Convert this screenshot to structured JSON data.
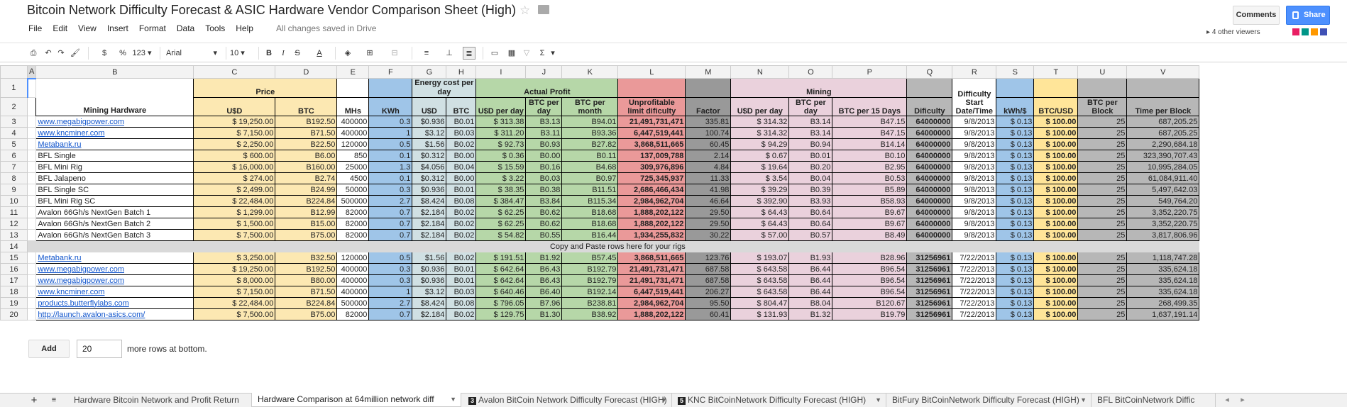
{
  "doc": {
    "title": "Bitcoin Network Difficulty Forecast & ASIC Hardware Vendor Comparison Sheet (High)",
    "comments_label": "Comments",
    "share_label": "Share",
    "saved_status": "All changes saved in Drive",
    "viewers": "4 other viewers",
    "viewer_colors": [
      "#e91e63",
      "#009688",
      "#ff9800",
      "#3f51b5"
    ]
  },
  "menu": [
    "File",
    "Edit",
    "View",
    "Insert",
    "Format",
    "Data",
    "Tools",
    "Help"
  ],
  "toolbar": {
    "font_name": "Arial",
    "font_size": "10",
    "currency": "$",
    "percent": "%",
    "number_format": "123"
  },
  "columns": [
    "",
    "A",
    "B",
    "C",
    "D",
    "E",
    "F",
    "G",
    "H",
    "I",
    "J",
    "K",
    "L",
    "M",
    "N",
    "O",
    "P",
    "Q",
    "R",
    "S",
    "T",
    "U",
    "V"
  ],
  "header": {
    "price": "Price",
    "energy": "Energy cost per day",
    "actual_profit": "Actual Profit",
    "mining": "Mining",
    "mining_hardware": "Mining Hardware",
    "usd": "U$D",
    "btc": "BTC",
    "mhs": "MHs",
    "kwh": "KWh",
    "energy_usd": "U$D",
    "energy_btc": "BTC",
    "usd_per_day": "U$D per day",
    "btc_per_day": "BTC per day",
    "btc_per_month": "BTC per month",
    "unprofitable": "Unprofitable limit dificulty",
    "factor": "Factor",
    "mining_usd_per_day": "U$D per day",
    "mining_btc_per_day": "BTC per day",
    "btc_per_15": "BTC per 15 Days",
    "dificulty": "Dificulty",
    "start": "Difficulty Start Date/Time",
    "kwh_usd": "kWh/$",
    "btc_usd": "BTC/USD",
    "btc_per_block": "BTC per Block",
    "time_per_block": "Time per Block"
  },
  "rows_a": [
    {
      "n": "3",
      "name": "www.megabigpower.com",
      "link": true,
      "usd": "$ 19,250.00",
      "btc": "B192.50",
      "mhs": "400000",
      "kwh": "0.3",
      "eusd": "$0.936",
      "ebtc": "B0.01",
      "pusd": "$ 313.38",
      "pbtc": "B3.13",
      "pmon": "B94.01",
      "unp": "21,491,731,471",
      "fac": "335.81",
      "musd": "$ 314.32",
      "mbtc": "B3.14",
      "m15": "B47.15",
      "dif": "64000000",
      "date": "9/8/2013",
      "kw": "$ 0.13",
      "bu": "$ 100.00",
      "bpb": "25",
      "tpb": "687,205.25"
    },
    {
      "n": "4",
      "name": "www.kncminer.com",
      "link": true,
      "usd": "$ 7,150.00",
      "btc": "B71.50",
      "mhs": "400000",
      "kwh": "1",
      "eusd": "$3.12",
      "ebtc": "B0.03",
      "pusd": "$ 311.20",
      "pbtc": "B3.11",
      "pmon": "B93.36",
      "unp": "6,447,519,441",
      "fac": "100.74",
      "musd": "$ 314.32",
      "mbtc": "B3.14",
      "m15": "B47.15",
      "dif": "64000000",
      "date": "9/8/2013",
      "kw": "$ 0.13",
      "bu": "$ 100.00",
      "bpb": "25",
      "tpb": "687,205.25"
    },
    {
      "n": "5",
      "name": "Metabank.ru",
      "link": true,
      "usd": "$ 2,250.00",
      "btc": "B22.50",
      "mhs": "120000",
      "kwh": "0.5",
      "eusd": "$1.56",
      "ebtc": "B0.02",
      "pusd": "$ 92.73",
      "pbtc": "B0.93",
      "pmon": "B27.82",
      "unp": "3,868,511,665",
      "fac": "60.45",
      "musd": "$ 94.29",
      "mbtc": "B0.94",
      "m15": "B14.14",
      "dif": "64000000",
      "date": "9/8/2013",
      "kw": "$ 0.13",
      "bu": "$ 100.00",
      "bpb": "25",
      "tpb": "2,290,684.18"
    },
    {
      "n": "6",
      "name": "BFL Single",
      "link": false,
      "usd": "$ 600.00",
      "btc": "B6.00",
      "mhs": "850",
      "kwh": "0.1",
      "eusd": "$0.312",
      "ebtc": "B0.00",
      "pusd": "$ 0.36",
      "pbtc": "B0.00",
      "pmon": "B0.11",
      "unp": "137,009,788",
      "fac": "2.14",
      "musd": "$ 0.67",
      "mbtc": "B0.01",
      "m15": "B0.10",
      "dif": "64000000",
      "date": "9/8/2013",
      "kw": "$ 0.13",
      "bu": "$ 100.00",
      "bpb": "25",
      "tpb": "323,390,707.43"
    },
    {
      "n": "7",
      "name": "BFL Mini Rig",
      "link": false,
      "usd": "$ 16,000.00",
      "btc": "B160.00",
      "mhs": "25000",
      "kwh": "1.3",
      "eusd": "$4.056",
      "ebtc": "B0.04",
      "pusd": "$ 15.59",
      "pbtc": "B0.16",
      "pmon": "B4.68",
      "unp": "309,976,896",
      "fac": "4.84",
      "musd": "$ 19.64",
      "mbtc": "B0.20",
      "m15": "B2.95",
      "dif": "64000000",
      "date": "9/8/2013",
      "kw": "$ 0.13",
      "bu": "$ 100.00",
      "bpb": "25",
      "tpb": "10,995,284.05"
    },
    {
      "n": "8",
      "name": "BFL Jalapeno",
      "link": false,
      "usd": "$ 274.00",
      "btc": "B2.74",
      "mhs": "4500",
      "kwh": "0.1",
      "eusd": "$0.312",
      "ebtc": "B0.00",
      "pusd": "$ 3.22",
      "pbtc": "B0.03",
      "pmon": "B0.97",
      "unp": "725,345,937",
      "fac": "11.33",
      "musd": "$ 3.54",
      "mbtc": "B0.04",
      "m15": "B0.53",
      "dif": "64000000",
      "date": "9/8/2013",
      "kw": "$ 0.13",
      "bu": "$ 100.00",
      "bpb": "25",
      "tpb": "61,084,911.40"
    },
    {
      "n": "9",
      "name": "BFL Single SC",
      "link": false,
      "usd": "$ 2,499.00",
      "btc": "B24.99",
      "mhs": "50000",
      "kwh": "0.3",
      "eusd": "$0.936",
      "ebtc": "B0.01",
      "pusd": "$ 38.35",
      "pbtc": "B0.38",
      "pmon": "B11.51",
      "unp": "2,686,466,434",
      "fac": "41.98",
      "musd": "$ 39.29",
      "mbtc": "B0.39",
      "m15": "B5.89",
      "dif": "64000000",
      "date": "9/8/2013",
      "kw": "$ 0.13",
      "bu": "$ 100.00",
      "bpb": "25",
      "tpb": "5,497,642.03"
    },
    {
      "n": "10",
      "name": "BFL Mini Rig SC",
      "link": false,
      "usd": "$ 22,484.00",
      "btc": "B224.84",
      "mhs": "500000",
      "kwh": "2.7",
      "eusd": "$8.424",
      "ebtc": "B0.08",
      "pusd": "$ 384.47",
      "pbtc": "B3.84",
      "pmon": "B115.34",
      "unp": "2,984,962,704",
      "fac": "46.64",
      "musd": "$ 392.90",
      "mbtc": "B3.93",
      "m15": "B58.93",
      "dif": "64000000",
      "date": "9/8/2013",
      "kw": "$ 0.13",
      "bu": "$ 100.00",
      "bpb": "25",
      "tpb": "549,764.20"
    },
    {
      "n": "11",
      "name": "Avalon 66Gh/s NextGen Batch 1",
      "link": false,
      "usd": "$ 1,299.00",
      "btc": "B12.99",
      "mhs": "82000",
      "kwh": "0.7",
      "eusd": "$2.184",
      "ebtc": "B0.02",
      "pusd": "$ 62.25",
      "pbtc": "B0.62",
      "pmon": "B18.68",
      "unp": "1,888,202,122",
      "fac": "29.50",
      "musd": "$ 64.43",
      "mbtc": "B0.64",
      "m15": "B9.67",
      "dif": "64000000",
      "date": "9/8/2013",
      "kw": "$ 0.13",
      "bu": "$ 100.00",
      "bpb": "25",
      "tpb": "3,352,220.75"
    },
    {
      "n": "12",
      "name": "Avalon 66Gh/s NextGen Batch 2",
      "link": false,
      "usd": "$ 1,500.00",
      "btc": "B15.00",
      "mhs": "82000",
      "kwh": "0.7",
      "eusd": "$2.184",
      "ebtc": "B0.02",
      "pusd": "$ 62.25",
      "pbtc": "B0.62",
      "pmon": "B18.68",
      "unp": "1,888,202,122",
      "fac": "29.50",
      "musd": "$ 64.43",
      "mbtc": "B0.64",
      "m15": "B9.67",
      "dif": "64000000",
      "date": "9/8/2013",
      "kw": "$ 0.13",
      "bu": "$ 100.00",
      "bpb": "25",
      "tpb": "3,352,220.75"
    },
    {
      "n": "13",
      "name": "Avalon 66Gh/s NextGen Batch 3",
      "link": false,
      "usd": "$ 7,500.00",
      "btc": "B75.00",
      "mhs": "82000",
      "kwh": "0.7",
      "eusd": "$2.184",
      "ebtc": "B0.02",
      "pusd": "$ 54.82",
      "pbtc": "B0.55",
      "pmon": "B16.44",
      "unp": "1,934,255,832",
      "fac": "30.22",
      "musd": "$ 57.00",
      "mbtc": "B0.57",
      "m15": "B8.49",
      "dif": "64000000",
      "date": "9/8/2013",
      "kw": "$ 0.13",
      "bu": "$ 100.00",
      "bpb": "25",
      "tpb": "3,817,806.96"
    }
  ],
  "row14": {
    "n": "14",
    "text": "Copy and Paste rows here for your rigs"
  },
  "rows_b": [
    {
      "n": "15",
      "name": "Metabank.ru",
      "link": true,
      "usd": "$ 3,250.00",
      "btc": "B32.50",
      "mhs": "120000",
      "kwh": "0.5",
      "eusd": "$1.56",
      "ebtc": "B0.02",
      "pusd": "$ 191.51",
      "pbtc": "B1.92",
      "pmon": "B57.45",
      "unp": "3,868,511,665",
      "fac": "123.76",
      "musd": "$ 193.07",
      "mbtc": "B1.93",
      "m15": "B28.96",
      "dif": "31256961",
      "date": "7/22/2013",
      "kw": "$ 0.13",
      "bu": "$ 100.00",
      "bpb": "25",
      "tpb": "1,118,747.28"
    },
    {
      "n": "16",
      "name": "www.megabigpower.com",
      "link": true,
      "usd": "$ 19,250.00",
      "btc": "B192.50",
      "mhs": "400000",
      "kwh": "0.3",
      "eusd": "$0.936",
      "ebtc": "B0.01",
      "pusd": "$ 642.64",
      "pbtc": "B6.43",
      "pmon": "B192.79",
      "unp": "21,491,731,471",
      "fac": "687.58",
      "musd": "$ 643.58",
      "mbtc": "B6.44",
      "m15": "B96.54",
      "dif": "31256961",
      "date": "7/22/2013",
      "kw": "$ 0.13",
      "bu": "$ 100.00",
      "bpb": "25",
      "tpb": "335,624.18"
    },
    {
      "n": "17",
      "name": "www.megabigpower.com",
      "link": true,
      "usd": "$ 8,000.00",
      "btc": "B80.00",
      "mhs": "400000",
      "kwh": "0.3",
      "eusd": "$0.936",
      "ebtc": "B0.01",
      "pusd": "$ 642.64",
      "pbtc": "B6.43",
      "pmon": "B192.79",
      "unp": "21,491,731,471",
      "fac": "687.58",
      "musd": "$ 643.58",
      "mbtc": "B6.44",
      "m15": "B96.54",
      "dif": "31256961",
      "date": "7/22/2013",
      "kw": "$ 0.13",
      "bu": "$ 100.00",
      "bpb": "25",
      "tpb": "335,624.18"
    },
    {
      "n": "18",
      "name": "www.kncminer.com",
      "link": true,
      "usd": "$ 7,150.00",
      "btc": "B71.50",
      "mhs": "400000",
      "kwh": "1",
      "eusd": "$3.12",
      "ebtc": "B0.03",
      "pusd": "$ 640.46",
      "pbtc": "B6.40",
      "pmon": "B192.14",
      "unp": "6,447,519,441",
      "fac": "206.27",
      "musd": "$ 643.58",
      "mbtc": "B6.44",
      "m15": "B96.54",
      "dif": "31256961",
      "date": "7/22/2013",
      "kw": "$ 0.13",
      "bu": "$ 100.00",
      "bpb": "25",
      "tpb": "335,624.18"
    },
    {
      "n": "19",
      "name": "products.butterflylabs.com",
      "link": true,
      "usd": "$ 22,484.00",
      "btc": "B224.84",
      "mhs": "500000",
      "kwh": "2.7",
      "eusd": "$8.424",
      "ebtc": "B0.08",
      "pusd": "$ 796.05",
      "pbtc": "B7.96",
      "pmon": "B238.81",
      "unp": "2,984,962,704",
      "fac": "95.50",
      "musd": "$ 804.47",
      "mbtc": "B8.04",
      "m15": "B120.67",
      "dif": "31256961",
      "date": "7/22/2013",
      "kw": "$ 0.13",
      "bu": "$ 100.00",
      "bpb": "25",
      "tpb": "268,499.35"
    },
    {
      "n": "20",
      "name": "http://launch.avalon-asics.com/",
      "link": true,
      "usd": "$ 7,500.00",
      "btc": "B75.00",
      "mhs": "82000",
      "kwh": "0.7",
      "eusd": "$2.184",
      "ebtc": "B0.02",
      "pusd": "$ 129.75",
      "pbtc": "B1.30",
      "pmon": "B38.92",
      "unp": "1,888,202,122",
      "fac": "60.41",
      "musd": "$ 131.93",
      "mbtc": "B1.32",
      "m15": "B19.79",
      "dif": "31256961",
      "date": "7/22/2013",
      "kw": "$ 0.13",
      "bu": "$ 100.00",
      "bpb": "25",
      "tpb": "1,637,191.14"
    }
  ],
  "add_rows": {
    "button": "Add",
    "count": "20",
    "suffix": "more rows at bottom."
  },
  "tabs": [
    {
      "label": "Hardware Bitcoin Network and Profit Return",
      "badge": ""
    },
    {
      "label": "Hardware Comparison at 64million network diff",
      "badge": ""
    },
    {
      "label": "Avalon BitCoin Network Difficulty Forecast (HIGH)",
      "badge": "3"
    },
    {
      "label": "KNC BitCoinNetwork Difficulty Forecast (HIGH)",
      "badge": "5"
    },
    {
      "label": "BitFury BitCoinNetwork Difficulty Forecast (HIGH)",
      "badge": ""
    },
    {
      "label": "BFL BitCoinNetwork Diffic",
      "badge": ""
    }
  ],
  "colors": {
    "price": "#fce8b2",
    "energy": "#d0e0e3",
    "profit": "#b6d7a8",
    "unprofitable": "#ea9999",
    "factor": "#999999",
    "mining": "#ead1dc",
    "dificulty": "#b7b7b7",
    "kwh": "#9fc5e8",
    "btcusd": "#ffe599",
    "gray": "#b7b7b7"
  }
}
